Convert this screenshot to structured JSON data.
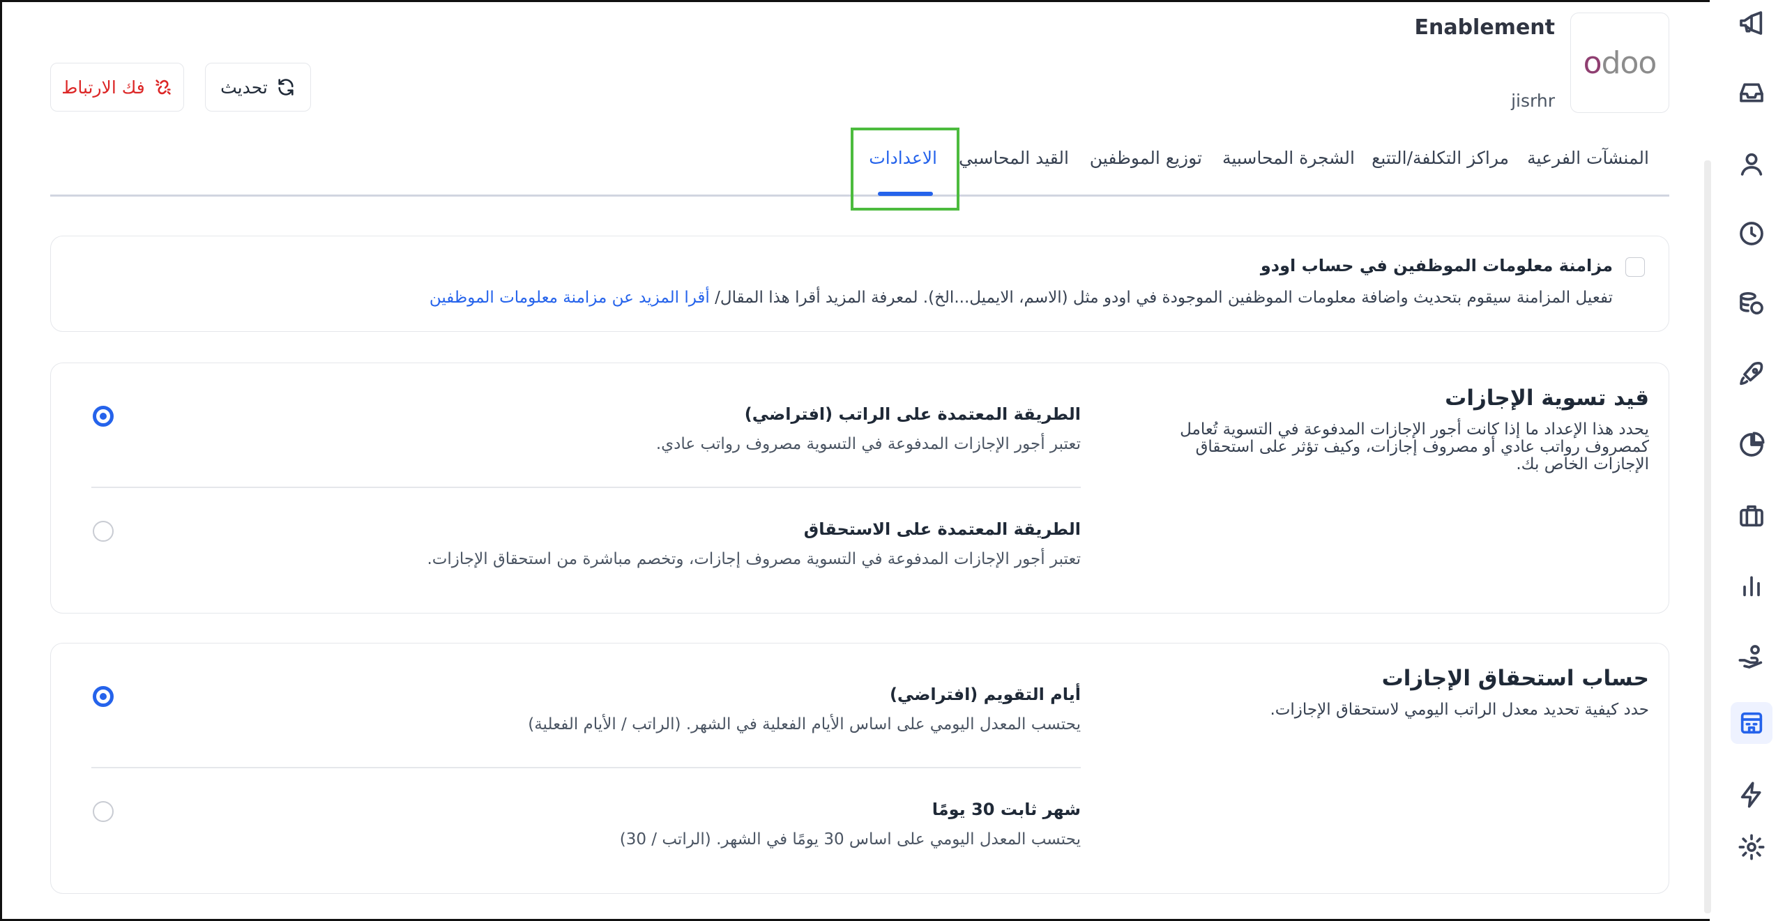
{
  "header": {
    "company_name": "Enablement",
    "company_db": "jisrhr",
    "logo_first": "o",
    "logo_rest": "doo",
    "unlink_label": "فك الارتباط",
    "refresh_label": "تحديث"
  },
  "tabs": [
    {
      "label": "المنشآت الفرعية"
    },
    {
      "label": "مراكز التكلفة/التتبع"
    },
    {
      "label": "الشجرة المحاسبية"
    },
    {
      "label": "توزيع الموظفين"
    },
    {
      "label": "القيد المحاسبي"
    },
    {
      "label": "الاعدادات",
      "active": true
    }
  ],
  "sync": {
    "title": "مزامنة معلومات الموظفين في حساب اودو",
    "description": "تفعيل المزامنة سيقوم بتحديث واضافة معلومات الموظفين الموجودة في اودو مثل (الاسم، الايميل...الخ). لمعرفة المزيد أقرا هذا المقال/",
    "link": "أقرا المزيد عن مزامنة معلومات الموظفين",
    "checked": false
  },
  "leave_settlement": {
    "title": "قيد تسوية الإجازات",
    "description": "يحدد هذا الإعداد ما إذا كانت أجور الإجازات المدفوعة في التسوية تُعامل كمصروف رواتب عادي أو مصروف إجازات، وكيف تؤثر على استحقاق الإجازات الخاص بك.",
    "options": [
      {
        "title": "الطريقة المعتمدة على الراتب (افتراضي)",
        "description": "تعتبر أجور الإجازات المدفوعة في التسوية مصروف رواتب عادي.",
        "selected": true
      },
      {
        "title": "الطريقة المعتمدة على الاستحقاق",
        "description": "تعتبر أجور الإجازات المدفوعة في التسوية مصروف إجازات، وتخصم مباشرة من استحقاق الإجازات.",
        "selected": false
      }
    ]
  },
  "leave_accrual": {
    "title": "حساب استحقاق الإجازات",
    "description": "حدد كيفية تحديد معدل الراتب اليومي لاستحقاق الإجازات.",
    "options": [
      {
        "title": "أيام التقويم (افتراضي)",
        "description": "يحتسب المعدل اليومي على اساس الأيام الفعلية في الشهر. (الراتب / الأيام الفعلية)",
        "selected": true
      },
      {
        "title": "شهر ثابت 30 يومًا",
        "description": "يحتسب المعدل اليومي على اساس 30 يومًا في الشهر. (الراتب / 30)",
        "selected": false
      }
    ]
  },
  "sidebar": {
    "items": [
      {
        "icon": "megaphone-icon"
      },
      {
        "icon": "inbox-icon"
      },
      {
        "icon": "user-icon"
      },
      {
        "icon": "clock-icon"
      },
      {
        "icon": "coins-icon"
      },
      {
        "icon": "rocket-icon"
      },
      {
        "icon": "pie-chart-icon"
      },
      {
        "icon": "briefcase-icon"
      },
      {
        "icon": "bar-chart-icon"
      },
      {
        "icon": "hand-coin-icon"
      },
      {
        "icon": "building-icon",
        "active": true
      },
      {
        "icon": "lightning-icon"
      },
      {
        "icon": "gear-icon"
      }
    ]
  },
  "colors": {
    "accent": "#2563eb",
    "danger": "#dc2626",
    "highlight": "#4cbb3e"
  }
}
